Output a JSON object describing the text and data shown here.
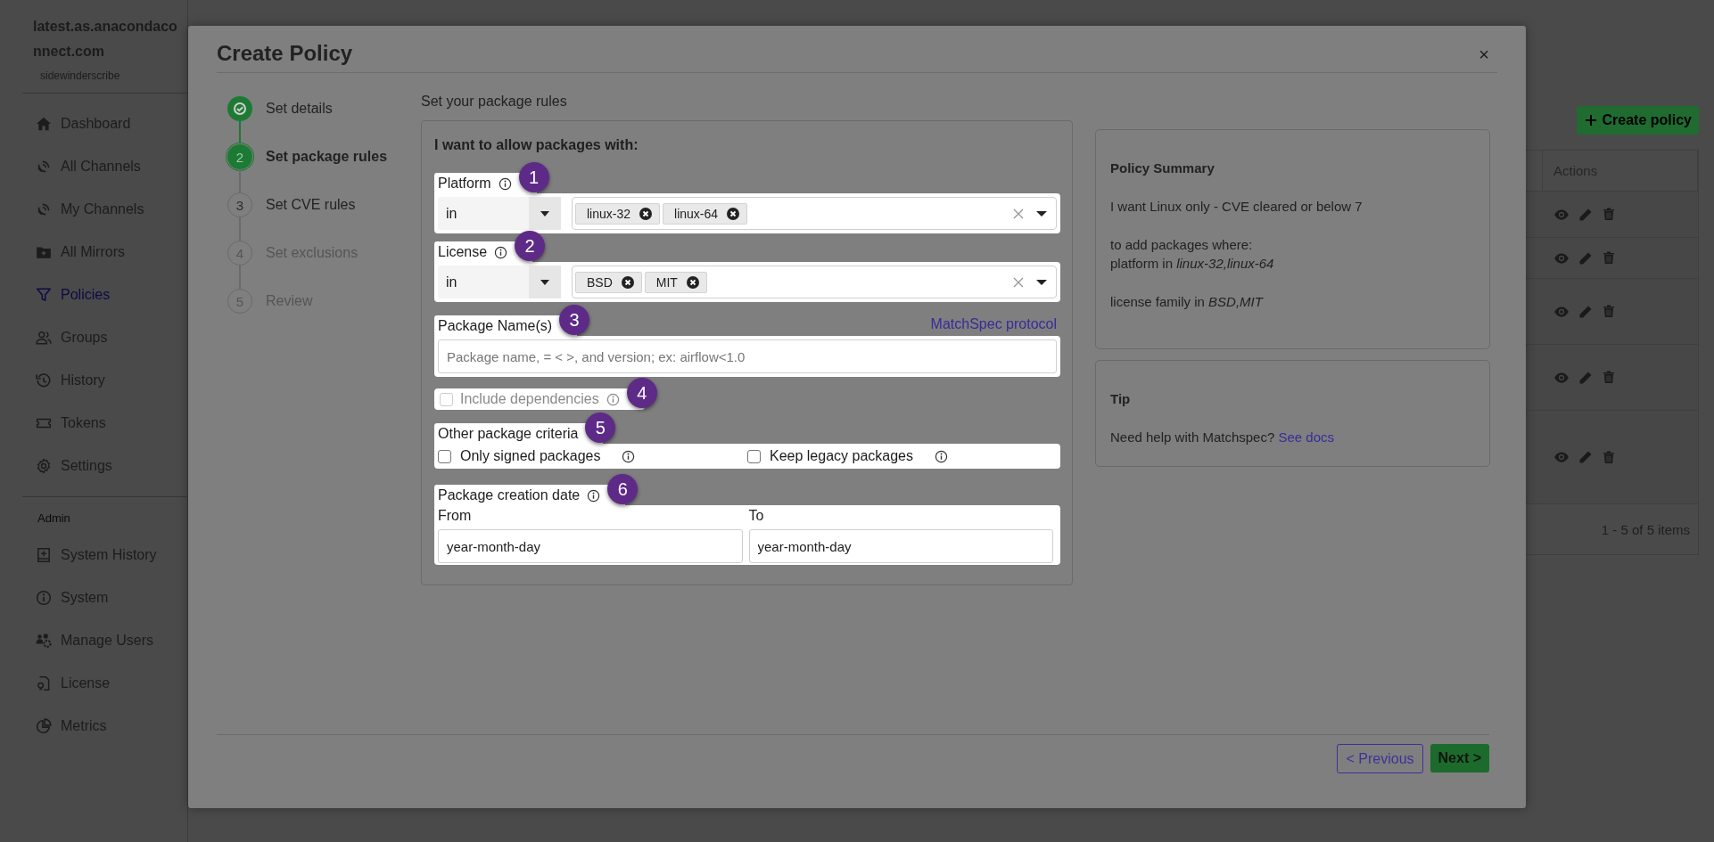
{
  "sidebar": {
    "org": "latest.as.anacondaconnect.com",
    "user": "sidewinderscribe",
    "items": [
      {
        "label": "Dashboard",
        "selected": false
      },
      {
        "label": "All Channels",
        "selected": false
      },
      {
        "label": "My Channels",
        "selected": false
      },
      {
        "label": "All Mirrors",
        "selected": false
      },
      {
        "label": "Policies",
        "selected": true
      },
      {
        "label": "Groups",
        "selected": false
      },
      {
        "label": "History",
        "selected": false
      },
      {
        "label": "Tokens",
        "selected": false
      },
      {
        "label": "Settings",
        "selected": false
      }
    ],
    "admin_label": "Admin",
    "admin_items": [
      {
        "label": "System History",
        "selected": false
      },
      {
        "label": "System",
        "selected": false
      },
      {
        "label": "Manage Users",
        "selected": false
      },
      {
        "label": "License",
        "selected": false
      },
      {
        "label": "Metrics",
        "selected": false
      }
    ]
  },
  "page": {
    "create_button": "Create policy",
    "table": {
      "columns": [
        "Actions"
      ],
      "pagination": "1 - 5 of 5 items"
    }
  },
  "modal": {
    "title": "Create Policy",
    "close": "×",
    "steps": [
      {
        "label": "Set details",
        "done": true,
        "selected": false,
        "disabled": false
      },
      {
        "number": "2",
        "label": "Set package rules",
        "done": false,
        "selected": true,
        "disabled": false
      },
      {
        "number": "3",
        "label": "Set CVE rules",
        "done": false,
        "selected": false,
        "disabled": false
      },
      {
        "number": "4",
        "label": "Set exclusions",
        "done": false,
        "selected": false,
        "disabled": true
      },
      {
        "number": "5",
        "label": "Review",
        "done": false,
        "selected": false,
        "disabled": true
      }
    ],
    "section_title": "Set your package rules",
    "form": {
      "heading": "I want to allow packages with:",
      "selects": [
        {
          "label": "Platform",
          "badge": "1",
          "operator": "in",
          "tags": [
            "linux-32",
            "linux-64"
          ]
        },
        {
          "label": "License",
          "badge": "2",
          "operator": "in",
          "tags": [
            "BSD",
            "MIT"
          ]
        }
      ],
      "package_names": {
        "label": "Package Name(s)",
        "badge": "3",
        "link": "MatchSpec protocol",
        "placeholder": "Package name, = < >, and version; ex: airflow<1.0"
      },
      "include_dependencies": {
        "label": "Include dependencies",
        "badge": "4",
        "checked": false,
        "disabled": true
      },
      "other_criteria": {
        "label": "Other package criteria",
        "badge": "5",
        "options": [
          {
            "label": "Only signed packages",
            "checked": false
          },
          {
            "label": "Keep legacy packages",
            "checked": false
          }
        ]
      },
      "creation_date": {
        "label": "Package creation date",
        "badge": "6",
        "fields": [
          {
            "label": "From",
            "placeholder": "year-month-day"
          },
          {
            "label": "To",
            "placeholder": "year-month-day"
          }
        ]
      }
    },
    "summary": {
      "title": "Policy Summary",
      "paragraphs": [
        [
          "I want Linux only - CVE cleared or below 7"
        ],
        [
          "to add packages where:",
          "platform in *linux-32,linux-64*"
        ],
        [
          "license family in *BSD,MIT*"
        ]
      ]
    },
    "tip": {
      "title": "Tip",
      "text": "Need help with Matchspec?",
      "link": "See docs"
    },
    "buttons": {
      "previous": "< Previous",
      "next": "Next >"
    }
  }
}
